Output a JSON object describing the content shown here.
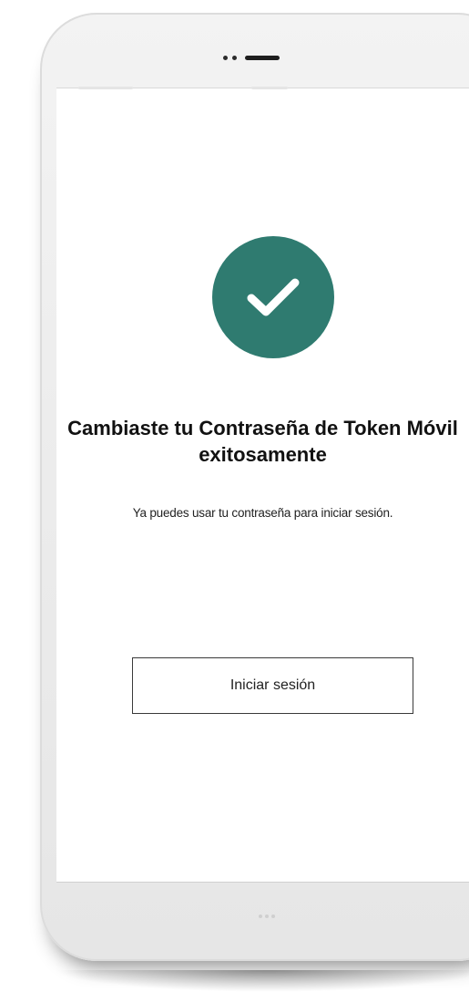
{
  "screen": {
    "success_icon": "checkmark-icon",
    "title": "Cambiaste tu Contraseña de Token Móvil exitosamente",
    "message": "Ya puedes usar tu contraseña para iniciar sesión.",
    "login_button_label": "Iniciar sesión"
  },
  "colors": {
    "accent": "#2f7b70",
    "text": "#111111",
    "button_border": "#3a3a3a"
  }
}
